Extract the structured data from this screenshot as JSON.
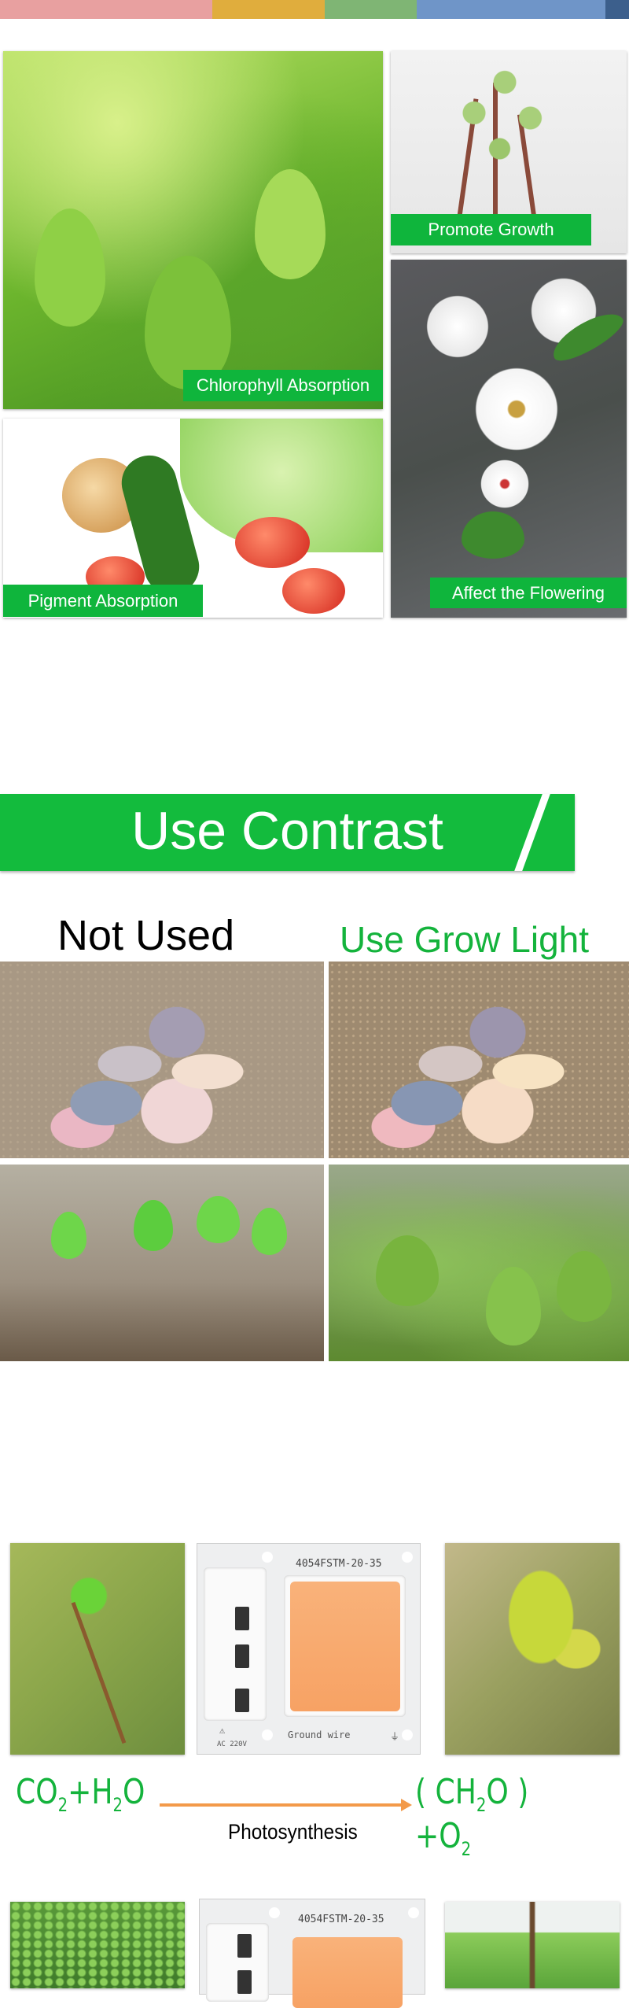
{
  "top_strip_colors": [
    "#e8a0a0",
    "#e0ad3d",
    "#7fb574",
    "#6f95c8",
    "#3c5f8c"
  ],
  "features": {
    "chlorophyll_label": "Chlorophyll Absorption",
    "promote_growth_label": "Promote Growth",
    "pigment_label": "Pigment Absorption",
    "flowering_label": "Affect the Flowering"
  },
  "contrast": {
    "title": "Use Contrast",
    "not_used_label": "Not Used",
    "grow_light_label": "Use Grow Light"
  },
  "photosynthesis": {
    "chip_model": "4054FSTM-20-35",
    "chip_ground_label": "Ground wire",
    "chip_voltage_label": "AC 220V",
    "reactant_1": "CO",
    "reactant_1_sub": "2",
    "plus_1": "+H",
    "reactant_2_sub": "2",
    "reactant_2_tail": "O",
    "product_1_open": "( CH",
    "product_1_sub": "2",
    "product_1_close": "O ) +O",
    "product_2_sub": "2",
    "caption": "Photosynthesis",
    "arrow_color": "#f39a4a",
    "accent_green": "#14b33c"
  }
}
